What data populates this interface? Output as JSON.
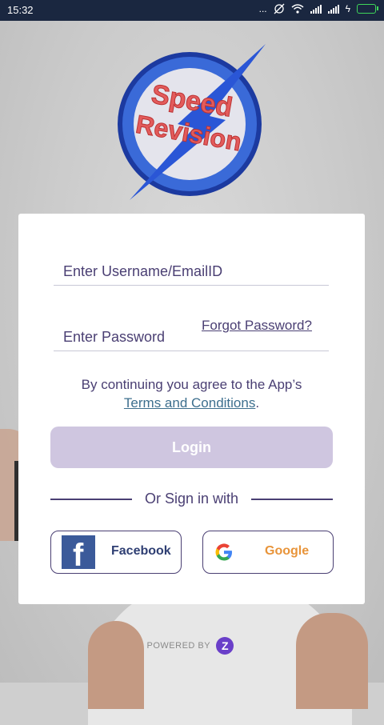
{
  "status_bar": {
    "time": "15:32",
    "dots": "...",
    "charge_symbol": "ϟ"
  },
  "logo": {
    "line1": "Speed",
    "line2": "Revision"
  },
  "form": {
    "username_placeholder": "Enter Username/EmailID",
    "password_placeholder": "Enter Password",
    "forgot_label": "Forgot Password?",
    "agree_text": "By continuing you agree to the App’s",
    "terms_label": "Terms and Conditions",
    "terms_suffix": ".",
    "login_label": "Login",
    "divider_text": "Or Sign in with",
    "facebook_label": "Facebook",
    "google_label": "Google"
  },
  "footer": {
    "powered_prefix": "POWERED BY",
    "logo_letter": "Z",
    "powered_suffix": ""
  },
  "colors": {
    "accent": "#4a3f73",
    "login_disabled": "#cfc6e0",
    "facebook": "#3b5a9a",
    "google_label": "#e8943a"
  },
  "icons": [
    "wifi-icon",
    "signal-icon",
    "battery-icon",
    "alarm-off-icon",
    "facebook-icon",
    "google-icon"
  ]
}
